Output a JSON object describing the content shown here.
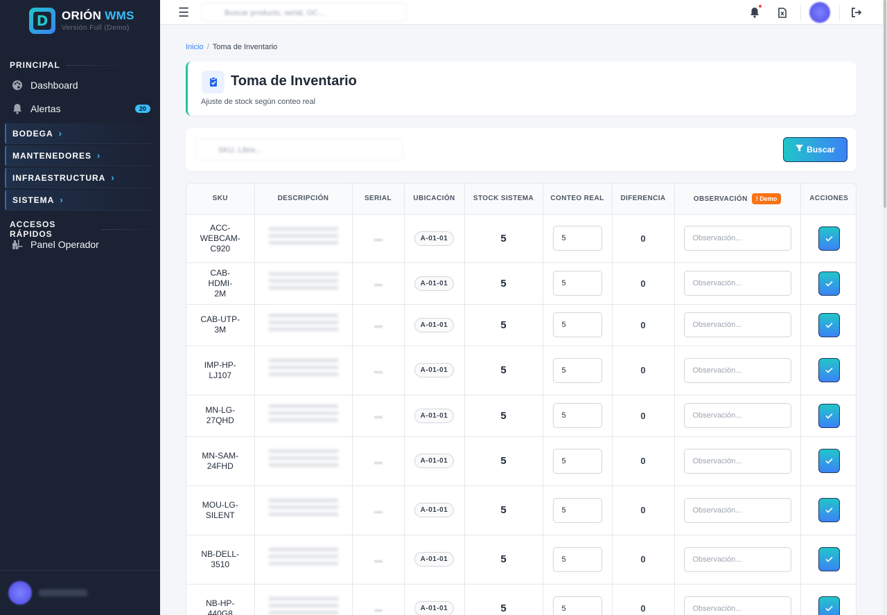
{
  "app": {
    "brand_name": "ORIÓN",
    "brand_accent": "WMS",
    "brand_sub": "Versión Full (Demo)",
    "logo_letter": "D"
  },
  "sidebar": {
    "principal_title": "PRINCIPAL",
    "items": [
      {
        "label": "Dashboard",
        "icon": "palette-icon"
      },
      {
        "label": "Alertas",
        "icon": "bell-icon",
        "badge": "20"
      }
    ],
    "groups": [
      {
        "label": "BODEGA"
      },
      {
        "label": "MANTENEDORES"
      },
      {
        "label": "INFRAESTRUCTURA"
      },
      {
        "label": "SISTEMA"
      }
    ],
    "quick_title": "ACCESOS RÁPIDOS",
    "quick_items": [
      {
        "label": "Panel Operador",
        "icon": "forklift-icon"
      }
    ]
  },
  "topbar": {
    "search_placeholder": "Buscar producto, serial, OC..."
  },
  "breadcrumb": {
    "home": "Inicio",
    "current": "Toma de Inventario"
  },
  "header": {
    "title": "Toma de Inventario",
    "subtitle": "Ajuste de stock según conteo real"
  },
  "filter": {
    "placeholder": "SKU, Libre...",
    "button_label": "Buscar"
  },
  "table": {
    "columns": [
      "SKU",
      "DESCRIPCIÓN",
      "SERIAL",
      "UBICACIÓN",
      "STOCK SISTEMA",
      "CONTEO REAL",
      "DIFERENCIA",
      "OBSERVACIÓN",
      "ACCIONES"
    ],
    "demo_badge": "! Demo",
    "obs_placeholder": "Observación...",
    "rows": [
      {
        "sku": "ACC-WEBCAM-C920",
        "sku_lines": [
          "ACC-",
          "WEBCAM-",
          "C920"
        ],
        "location": "A-01-01",
        "stock": "5",
        "count": "5",
        "diff": "0"
      },
      {
        "sku": "CAB-HDMI-2M",
        "sku_lines": [
          "CAB-HDMI-",
          "2M"
        ],
        "location": "A-01-01",
        "stock": "5",
        "count": "5",
        "diff": "0"
      },
      {
        "sku": "CAB-UTP-3M",
        "sku_lines": [
          "CAB-UTP-",
          "3M"
        ],
        "location": "A-01-01",
        "stock": "5",
        "count": "5",
        "diff": "0"
      },
      {
        "sku": "IMP-HP-LJ107",
        "sku_lines": [
          "IMP-HP-",
          "LJ107"
        ],
        "location": "A-01-01",
        "stock": "5",
        "count": "5",
        "diff": "0"
      },
      {
        "sku": "MN-LG-27QHD",
        "sku_lines": [
          "MN-LG-",
          "27QHD"
        ],
        "location": "A-01-01",
        "stock": "5",
        "count": "5",
        "diff": "0"
      },
      {
        "sku": "MN-SAM-24FHD",
        "sku_lines": [
          "MN-SAM-",
          "24FHD"
        ],
        "location": "A-01-01",
        "stock": "5",
        "count": "5",
        "diff": "0"
      },
      {
        "sku": "MOU-LG-SILENT",
        "sku_lines": [
          "MOU-LG-",
          "SILENT"
        ],
        "location": "A-01-01",
        "stock": "5",
        "count": "5",
        "diff": "0"
      },
      {
        "sku": "NB-DELL-3510",
        "sku_lines": [
          "NB-DELL-",
          "3510"
        ],
        "location": "A-01-01",
        "stock": "5",
        "count": "5",
        "diff": "0"
      },
      {
        "sku": "NB-HP-440G8",
        "sku_lines": [
          "NB-HP-",
          "440G8"
        ],
        "location": "A-01-01",
        "stock": "5",
        "count": "5",
        "diff": "0"
      }
    ]
  },
  "colors": {
    "sidebar_bg": "#1b2233",
    "accent": "#22c5c9",
    "accent2": "#3b82f6",
    "demo_badge": "#f97316"
  }
}
